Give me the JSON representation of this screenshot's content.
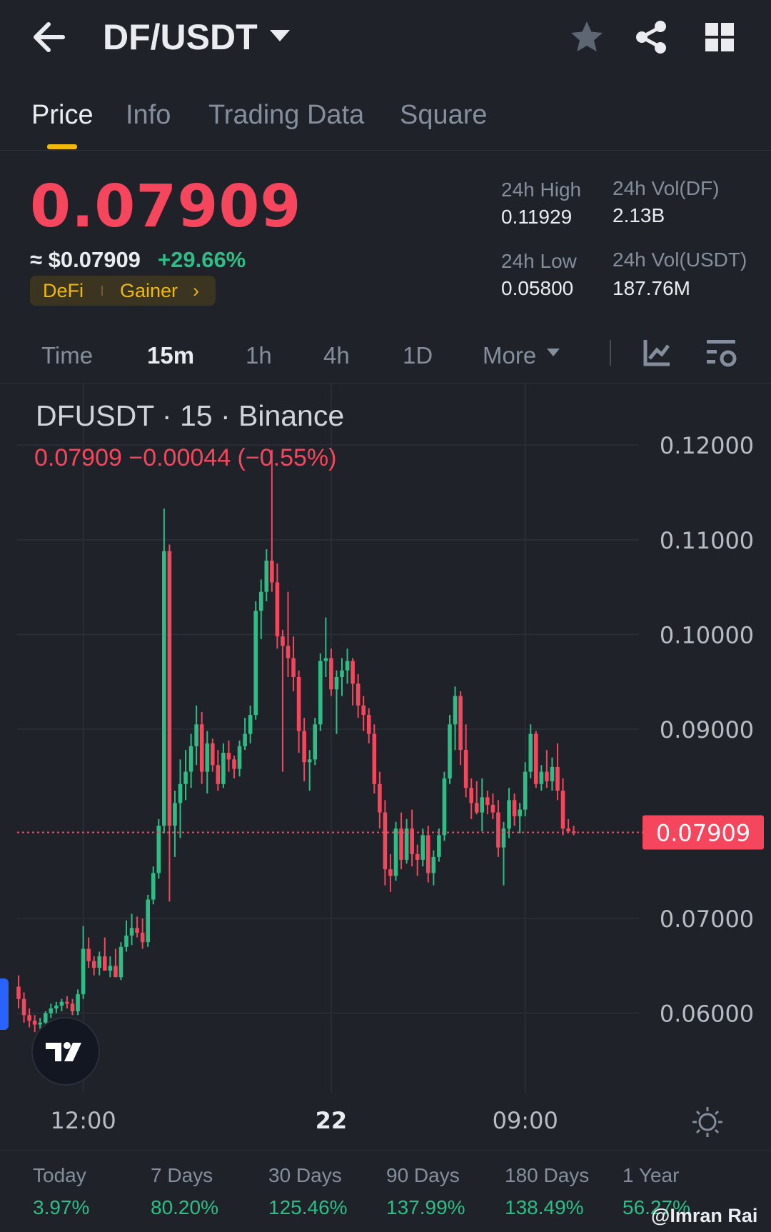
{
  "header": {
    "pair": "DF/USDT",
    "icons": [
      "back-arrow-icon",
      "chevron-down-icon",
      "star-icon",
      "share-icon",
      "grid-icon"
    ]
  },
  "tabs": [
    {
      "label": "Price",
      "active": true
    },
    {
      "label": "Info",
      "active": false
    },
    {
      "label": "Trading Data",
      "active": false
    },
    {
      "label": "Square",
      "active": false
    }
  ],
  "price": {
    "last": "0.07909",
    "approx": "≈ $0.07909",
    "change": "+29.66%",
    "tags": [
      "DeFi",
      "Gainer"
    ],
    "tag_chevron": "›"
  },
  "stats": {
    "high_label": "24h High",
    "high_value": "0.11929",
    "low_label": "24h Low",
    "low_value": "0.05800",
    "vol_base_label": "24h Vol(DF)",
    "vol_base_value": "2.13B",
    "vol_quote_label": "24h Vol(USDT)",
    "vol_quote_value": "187.76M"
  },
  "intervals": [
    {
      "label": "Time",
      "active": false
    },
    {
      "label": "15m",
      "active": true
    },
    {
      "label": "1h",
      "active": false
    },
    {
      "label": "4h",
      "active": false
    },
    {
      "label": "1D",
      "active": false
    },
    {
      "label": "More",
      "active": false
    }
  ],
  "colors": {
    "up": "#2ebd85",
    "down": "#f6465d",
    "accent": "#f0b90b",
    "bg": "#1f2329",
    "grid": "#2b3139",
    "axis_text": "#b7bdc6"
  },
  "chart_data": {
    "type": "candlestick",
    "symbol_line": "DFUSDT · 15 · Binance",
    "ohlc_line": "0.07909  −0.00044 (−0.55%)",
    "y_ticks": [
      "0.12000",
      "0.11000",
      "0.10000",
      "0.09000",
      "0.07000",
      "0.06000"
    ],
    "y_tick_values": [
      0.12,
      0.11,
      0.1,
      0.09,
      0.07,
      0.06
    ],
    "ylim": [
      0.0516,
      0.1265
    ],
    "current_price_label": "0.07909",
    "current_price": 0.07909,
    "x_ticks": [
      {
        "label": "12:00",
        "index": 12,
        "bold": false
      },
      {
        "label": "22",
        "index": 58,
        "bold": true
      },
      {
        "label": "09:00",
        "index": 94,
        "bold": false
      }
    ],
    "candles": [
      [
        0.0628,
        0.064,
        0.0605,
        0.0615
      ],
      [
        0.0615,
        0.0622,
        0.059,
        0.0598
      ],
      [
        0.0598,
        0.0605,
        0.0585,
        0.0592
      ],
      [
        0.0592,
        0.0598,
        0.058,
        0.0588
      ],
      [
        0.0588,
        0.0595,
        0.0582,
        0.059
      ],
      [
        0.059,
        0.0602,
        0.0586,
        0.06
      ],
      [
        0.06,
        0.061,
        0.0595,
        0.0605
      ],
      [
        0.0605,
        0.0612,
        0.06,
        0.0608
      ],
      [
        0.0608,
        0.0615,
        0.0602,
        0.0612
      ],
      [
        0.0612,
        0.0618,
        0.0605,
        0.061
      ],
      [
        0.061,
        0.0615,
        0.0598,
        0.0602
      ],
      [
        0.0602,
        0.0625,
        0.0598,
        0.062
      ],
      [
        0.062,
        0.0692,
        0.0615,
        0.0668
      ],
      [
        0.0668,
        0.068,
        0.0648,
        0.0655
      ],
      [
        0.0655,
        0.066,
        0.064,
        0.0648
      ],
      [
        0.0648,
        0.0665,
        0.064,
        0.066
      ],
      [
        0.066,
        0.068,
        0.0652,
        0.0645
      ],
      [
        0.0645,
        0.066,
        0.0638,
        0.065
      ],
      [
        0.065,
        0.0668,
        0.0645,
        0.0638
      ],
      [
        0.0638,
        0.0675,
        0.0635,
        0.067
      ],
      [
        0.067,
        0.0698,
        0.0665,
        0.0682
      ],
      [
        0.0682,
        0.0705,
        0.0672,
        0.069
      ],
      [
        0.069,
        0.0702,
        0.068,
        0.0685
      ],
      [
        0.0685,
        0.07,
        0.0668,
        0.0675
      ],
      [
        0.0675,
        0.0725,
        0.067,
        0.072
      ],
      [
        0.072,
        0.0755,
        0.0715,
        0.0748
      ],
      [
        0.0748,
        0.0805,
        0.0742,
        0.0798
      ],
      [
        0.0798,
        0.1133,
        0.079,
        0.1088
      ],
      [
        0.1088,
        0.1095,
        0.0718,
        0.0798
      ],
      [
        0.0798,
        0.0835,
        0.0765,
        0.0822
      ],
      [
        0.0822,
        0.0868,
        0.0785,
        0.0842
      ],
      [
        0.0842,
        0.0878,
        0.0825,
        0.0855
      ],
      [
        0.0855,
        0.0895,
        0.0838,
        0.0882
      ],
      [
        0.0882,
        0.0925,
        0.0862,
        0.0905
      ],
      [
        0.0905,
        0.0918,
        0.0842,
        0.0855
      ],
      [
        0.0855,
        0.0898,
        0.0832,
        0.0885
      ],
      [
        0.0885,
        0.089,
        0.0855,
        0.0862
      ],
      [
        0.0862,
        0.0878,
        0.0835,
        0.0842
      ],
      [
        0.0842,
        0.0885,
        0.0838,
        0.0875
      ],
      [
        0.0875,
        0.0888,
        0.0855,
        0.0868
      ],
      [
        0.0868,
        0.0872,
        0.0848,
        0.0858
      ],
      [
        0.0858,
        0.0888,
        0.085,
        0.0882
      ],
      [
        0.0882,
        0.0912,
        0.0878,
        0.0895
      ],
      [
        0.0895,
        0.0925,
        0.0885,
        0.0915
      ],
      [
        0.0915,
        0.1035,
        0.091,
        0.1025
      ],
      [
        0.1025,
        0.1058,
        0.0995,
        0.1045
      ],
      [
        0.1045,
        0.109,
        0.1035,
        0.1078
      ],
      [
        0.1078,
        0.1195,
        0.1045,
        0.1055
      ],
      [
        0.1055,
        0.1075,
        0.0985,
        0.0998
      ],
      [
        0.0998,
        0.1005,
        0.0855,
        0.0988
      ],
      [
        0.0988,
        0.1045,
        0.0955,
        0.0975
      ],
      [
        0.0975,
        0.0998,
        0.094,
        0.0955
      ],
      [
        0.0955,
        0.0962,
        0.0875,
        0.0898
      ],
      [
        0.0898,
        0.0912,
        0.0845,
        0.0865
      ],
      [
        0.0865,
        0.0878,
        0.0835,
        0.0868
      ],
      [
        0.0868,
        0.0912,
        0.0862,
        0.0905
      ],
      [
        0.0905,
        0.098,
        0.0898,
        0.0972
      ],
      [
        0.0972,
        0.1018,
        0.0955,
        0.0975
      ],
      [
        0.0975,
        0.0985,
        0.0935,
        0.0942
      ],
      [
        0.0942,
        0.0962,
        0.0895,
        0.0955
      ],
      [
        0.0955,
        0.0975,
        0.0935,
        0.0962
      ],
      [
        0.0962,
        0.0985,
        0.0948,
        0.0972
      ],
      [
        0.0972,
        0.0975,
        0.0925,
        0.0948
      ],
      [
        0.0948,
        0.0958,
        0.0912,
        0.0925
      ],
      [
        0.0925,
        0.0935,
        0.0898,
        0.0915
      ],
      [
        0.0915,
        0.0922,
        0.0885,
        0.0895
      ],
      [
        0.0895,
        0.0905,
        0.0832,
        0.0842
      ],
      [
        0.0842,
        0.0855,
        0.0795,
        0.0812
      ],
      [
        0.0812,
        0.0825,
        0.0735,
        0.0752
      ],
      [
        0.0752,
        0.0768,
        0.0728,
        0.0745
      ],
      [
        0.0745,
        0.0802,
        0.074,
        0.0795
      ],
      [
        0.0795,
        0.0812,
        0.0752,
        0.0762
      ],
      [
        0.0762,
        0.0805,
        0.0758,
        0.0795
      ],
      [
        0.0795,
        0.0815,
        0.0755,
        0.0768
      ],
      [
        0.0768,
        0.0778,
        0.0745,
        0.0762
      ],
      [
        0.0762,
        0.0795,
        0.0755,
        0.0788
      ],
      [
        0.0788,
        0.0798,
        0.0738,
        0.0748
      ],
      [
        0.0748,
        0.0772,
        0.0735,
        0.0765
      ],
      [
        0.0765,
        0.0795,
        0.076,
        0.0788
      ],
      [
        0.0788,
        0.0855,
        0.0782,
        0.0848
      ],
      [
        0.0848,
        0.0915,
        0.0842,
        0.0905
      ],
      [
        0.0905,
        0.0945,
        0.0878,
        0.0935
      ],
      [
        0.0935,
        0.094,
        0.0862,
        0.0878
      ],
      [
        0.0878,
        0.0905,
        0.0828,
        0.0838
      ],
      [
        0.0838,
        0.0848,
        0.0805,
        0.0822
      ],
      [
        0.0822,
        0.0845,
        0.081,
        0.0812
      ],
      [
        0.0812,
        0.0848,
        0.0792,
        0.0828
      ],
      [
        0.0828,
        0.0835,
        0.081,
        0.082
      ],
      [
        0.082,
        0.0832,
        0.0805,
        0.0812
      ],
      [
        0.0812,
        0.0825,
        0.0765,
        0.0775
      ],
      [
        0.0775,
        0.0802,
        0.0735,
        0.0795
      ],
      [
        0.0795,
        0.0838,
        0.0785,
        0.0825
      ],
      [
        0.0825,
        0.0832,
        0.0798,
        0.0808
      ],
      [
        0.0808,
        0.0822,
        0.079,
        0.0815
      ],
      [
        0.0815,
        0.0865,
        0.0808,
        0.0855
      ],
      [
        0.0855,
        0.0905,
        0.0848,
        0.0895
      ],
      [
        0.0895,
        0.0898,
        0.0838,
        0.0842
      ],
      [
        0.0842,
        0.0862,
        0.0835,
        0.0855
      ],
      [
        0.0855,
        0.0878,
        0.0838,
        0.0845
      ],
      [
        0.0845,
        0.087,
        0.0835,
        0.086
      ],
      [
        0.086,
        0.0885,
        0.0825,
        0.0835
      ],
      [
        0.0835,
        0.0848,
        0.0788,
        0.0795
      ],
      [
        0.0795,
        0.0805,
        0.079,
        0.0792
      ],
      [
        0.0792,
        0.0798,
        0.0788,
        0.0791
      ]
    ]
  },
  "performance": [
    {
      "label": "Today",
      "value": "3.97%"
    },
    {
      "label": "7 Days",
      "value": "80.20%"
    },
    {
      "label": "30 Days",
      "value": "125.46%"
    },
    {
      "label": "90 Days",
      "value": "137.99%"
    },
    {
      "label": "180 Days",
      "value": "138.49%"
    },
    {
      "label": "1 Year",
      "value": "56.27%"
    }
  ],
  "watermark": "@Imran Rai"
}
